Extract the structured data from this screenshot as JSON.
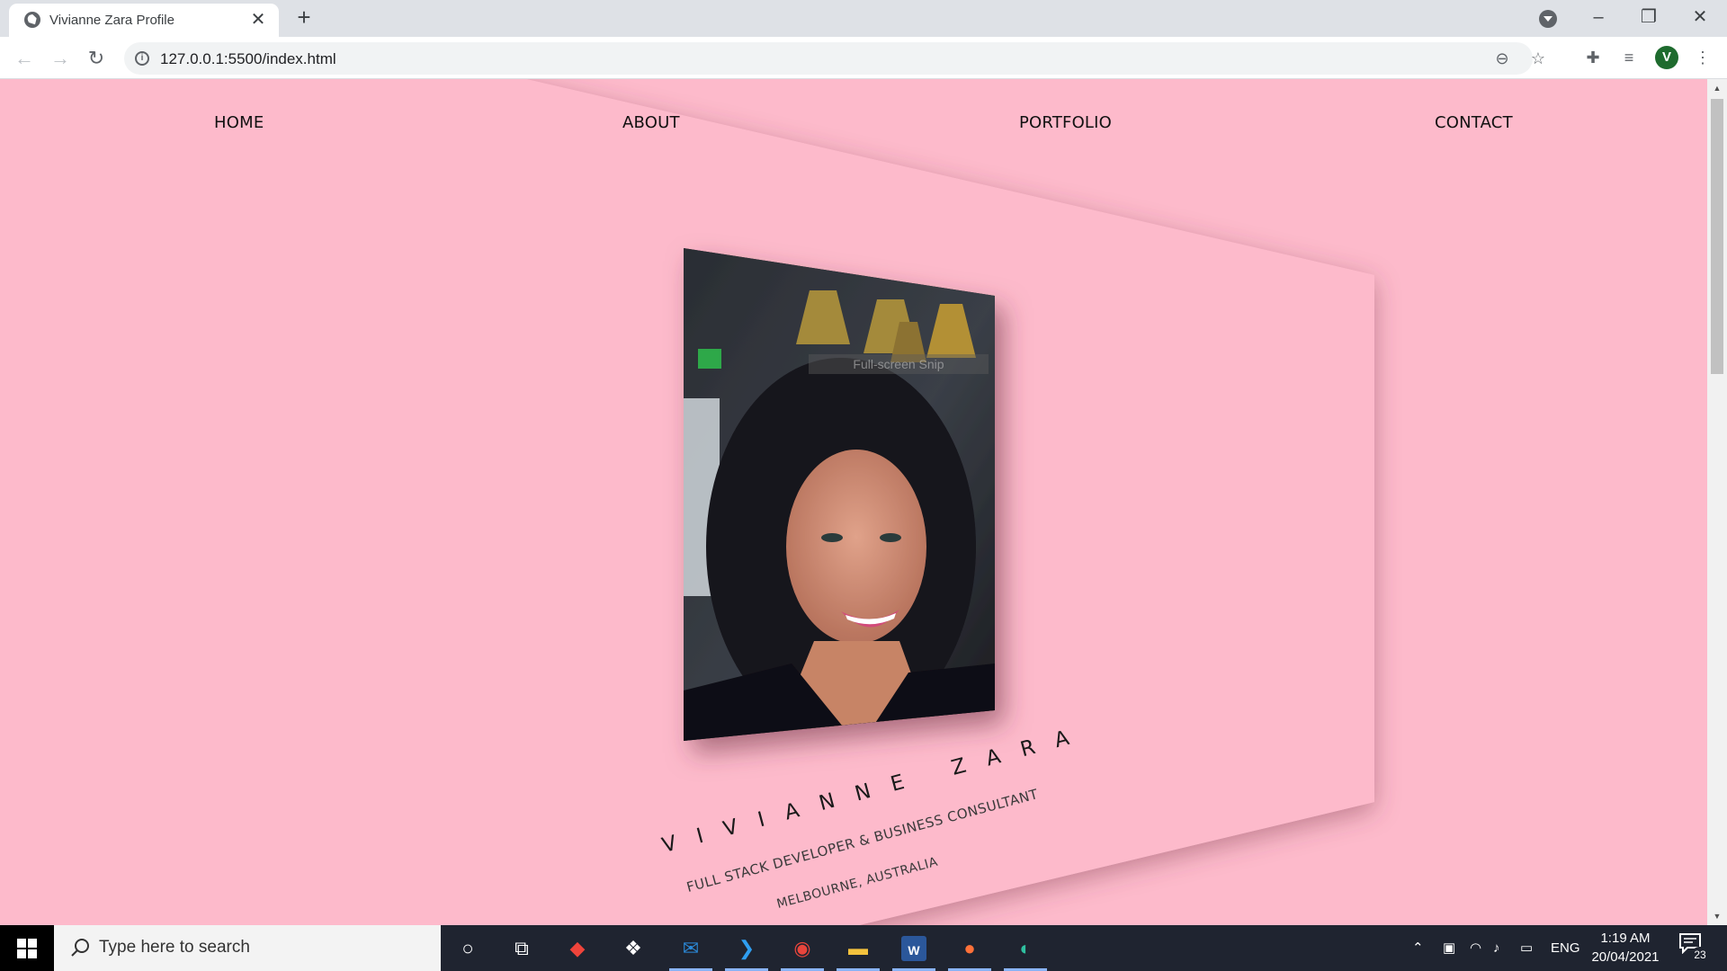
{
  "browser": {
    "tab_title": "Vivianne Zara Profile",
    "tab_close": "✕",
    "new_tab": "+",
    "url": "127.0.0.1:5500/index.html",
    "profile_initial": "V"
  },
  "page": {
    "nav": [
      "HOME",
      "ABOUT",
      "PORTFOLIO",
      "CONTACT"
    ],
    "name": "VIVIANNE ZARA",
    "role": "FULL STACK DEVELOPER & BUSINESS CONSULTANT",
    "location": "MELBOURNE, AUSTRALIA",
    "fullscreen_tip": "Full-screen Snip",
    "background_color": "#fdbacb"
  },
  "taskbar": {
    "search_placeholder": "Type here to search",
    "language": "ENG",
    "time": "1:19 AM",
    "date": "20/04/2021",
    "notification_count": "23"
  }
}
